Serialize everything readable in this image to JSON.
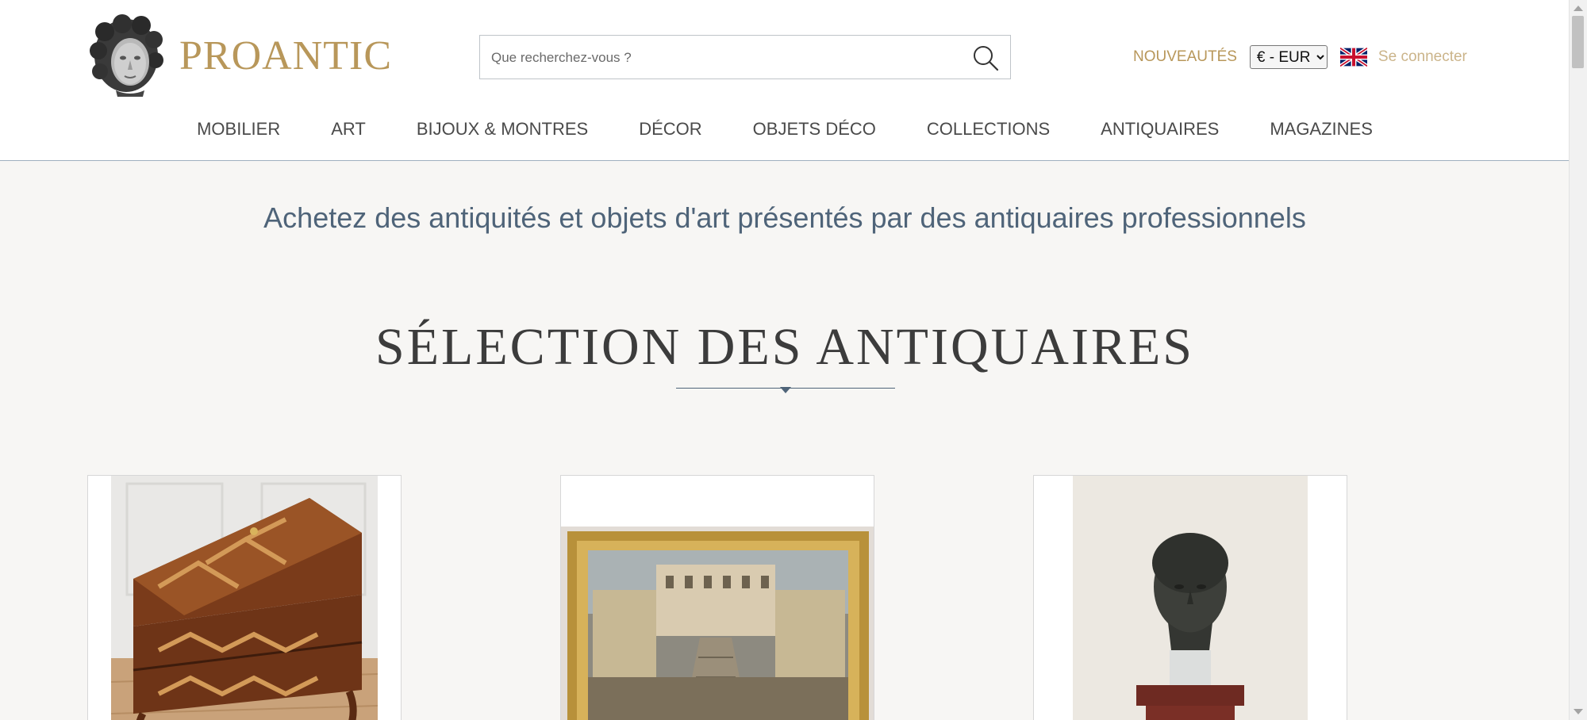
{
  "brand": {
    "name": "PROANTIC"
  },
  "search": {
    "placeholder": "Que recherchez-vous ?"
  },
  "header_links": {
    "new_label": "NOUVEAUTÉS",
    "currency_selected": "€ - EUR",
    "login_label": "Se connecter",
    "language_flag": "uk-flag-icon"
  },
  "nav": {
    "items": [
      {
        "label": "MOBILIER"
      },
      {
        "label": "ART"
      },
      {
        "label": "BIJOUX & MONTRES"
      },
      {
        "label": "DÉCOR"
      },
      {
        "label": "OBJETS DÉCO"
      },
      {
        "label": "COLLECTIONS"
      },
      {
        "label": "ANTIQUAIRES"
      },
      {
        "label": "MAGAZINES"
      }
    ]
  },
  "main": {
    "tagline": "Achetez des antiquités et objets d'art présentés par des antiquaires professionnels",
    "section_title": "SÉLECTION DES ANTIQUAIRES"
  },
  "colors": {
    "brand_gold": "#b8975a",
    "tagline_blue": "#4f6479",
    "background": "#f7f6f4"
  },
  "icons": {
    "search": "search-icon",
    "logo": "medusa-head-icon"
  }
}
